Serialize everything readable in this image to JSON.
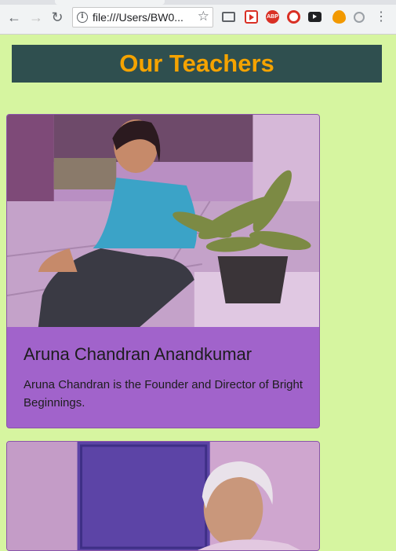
{
  "browser": {
    "address_bar": {
      "url": "file:///Users/BW0..."
    },
    "back_icon": "←",
    "forward_icon": "→",
    "reload_icon": "↻",
    "star_icon": "☆",
    "menu_icon": "⋮",
    "abp_label": "ABP"
  },
  "page": {
    "title": "Our Teachers"
  },
  "teachers": [
    {
      "name": "Aruna Chandran Anandkumar",
      "description": "Aruna Chandran is the Founder and Director of Bright Beginnings."
    }
  ],
  "colors": {
    "page_background": "#d6f5a0",
    "header_background": "#2f4f4f",
    "title_color": "#f5a300",
    "card_purple": "#a163cb"
  }
}
